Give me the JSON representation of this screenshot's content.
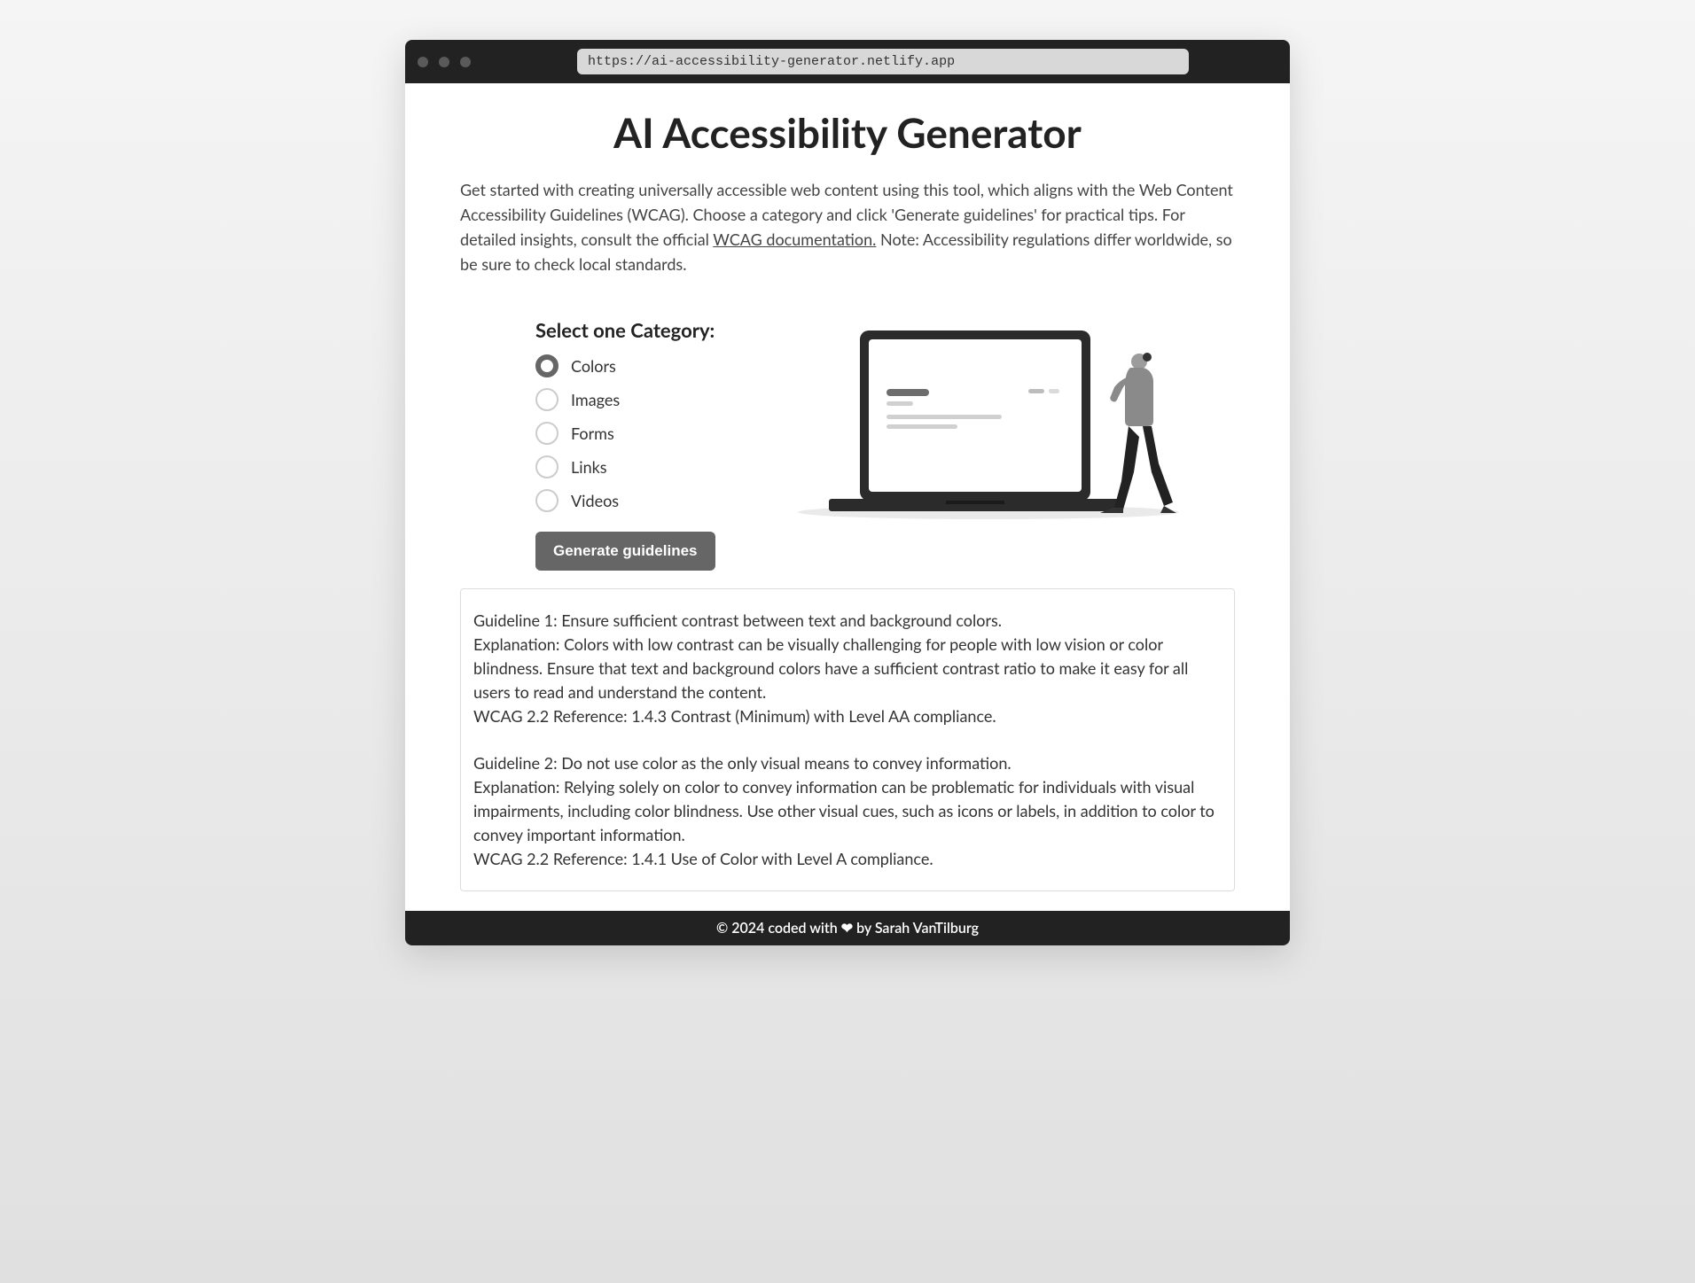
{
  "titlebar": {
    "url": "https://ai-accessibility-generator.netlify.app"
  },
  "header": {
    "title": "AI Accessibility Generator"
  },
  "intro": {
    "part1": "Get started with creating universally accessible web content using this tool, which aligns with the Web Content Accessibility Guidelines (WCAG). Choose a category and click 'Generate guidelines' for practical tips. For detailed insights, consult the official ",
    "link_text": "WCAG documentation.",
    "part2": "  Note: Accessibility regulations differ worldwide, so be sure to check local standards."
  },
  "form": {
    "heading": "Select one Category:",
    "options": [
      {
        "label": "Colors",
        "selected": true
      },
      {
        "label": "Images",
        "selected": false
      },
      {
        "label": "Forms",
        "selected": false
      },
      {
        "label": "Links",
        "selected": false
      },
      {
        "label": "Videos",
        "selected": false
      }
    ],
    "button_label": "Generate guidelines"
  },
  "results": [
    {
      "guideline": "Guideline 1: Ensure sufficient contrast between text and background colors.",
      "explanation": "Explanation: Colors with low contrast can be visually challenging for people with low vision or color blindness. Ensure that text and background colors have a sufficient contrast ratio to make it easy for all users to read and understand the content.",
      "reference": "WCAG 2.2 Reference: 1.4.3 Contrast (Minimum) with Level AA compliance."
    },
    {
      "guideline": "Guideline 2: Do not use color as the only visual means to convey information.",
      "explanation": "Explanation: Relying solely on color to convey information can be problematic for individuals with visual impairments, including color blindness. Use other visual cues, such as icons or labels, in addition to color to convey important information.",
      "reference": "WCAG 2.2 Reference: 1.4.1 Use of Color with Level A compliance."
    }
  ],
  "footer": {
    "prefix": "© 2024 coded with ",
    "suffix": " by Sarah VanTilburg"
  }
}
